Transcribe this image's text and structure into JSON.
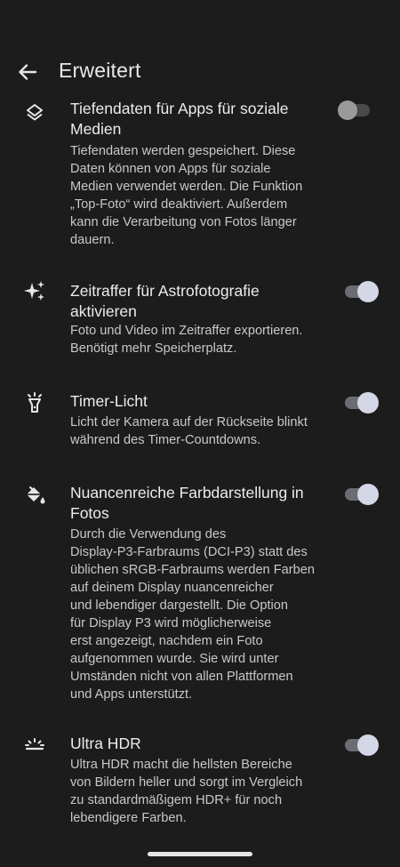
{
  "header": {
    "back_icon": "arrow-back-icon",
    "title": "Erweitert"
  },
  "settings": [
    {
      "icon": "layers-icon",
      "title": "Tiefendaten für Apps für soziale Medien",
      "title_lines": [
        "Tiefendaten für Apps für soziale",
        "Medien"
      ],
      "description_lines": [
        "Tiefendaten werden gespeichert. Diese",
        "Daten können von Apps für soziale",
        "Medien verwendet werden. Die Funktion",
        "„Top-Foto“ wird deaktiviert. Außerdem",
        "kann die Verarbeitung von Fotos länger",
        "dauern."
      ],
      "enabled": false
    },
    {
      "icon": "sparkle-icon",
      "title": "Zeitraffer für Astrofotografie aktivieren",
      "title_lines": [
        "Zeitraffer für Astrofotografie",
        "aktivieren"
      ],
      "description_lines": [
        "Foto und Video im Zeitraffer exportieren.",
        "Benötigt mehr Speicherplatz."
      ],
      "enabled": true
    },
    {
      "icon": "flashlight-icon",
      "title": "Timer-Licht",
      "title_lines": [
        "Timer-Licht"
      ],
      "description_lines": [
        "Licht der Kamera auf der Rückseite blinkt",
        "während des Timer-Countdowns."
      ],
      "enabled": true
    },
    {
      "icon": "paint-bucket-icon",
      "title": "Nuancenreiche Farbdarstellung in Fotos",
      "title_lines": [
        "Nuancenreiche Farbdarstellung in",
        "Fotos"
      ],
      "description_lines": [
        "Durch die Verwendung des",
        "Display-P3-Farbraums (DCI-P3) statt des",
        "üblichen sRGB-Farbraums werden Farben",
        "auf deinem Display nuancenreicher",
        "und lebendiger dargestellt. Die Option",
        "für Display P3 wird möglicherweise",
        "erst angezeigt, nachdem ein Foto",
        "aufgenommen wurde. Sie wird unter",
        "Umständen nicht von allen Plattformen",
        "und Apps unterstützt."
      ],
      "enabled": true
    },
    {
      "icon": "hdr-sunrise-icon",
      "title": "Ultra HDR",
      "title_lines": [
        "Ultra HDR"
      ],
      "description_lines": [
        "Ultra HDR macht die hellsten Bereiche",
        "von Bildern heller und sorgt im Vergleich",
        "zu standardmäßigem HDR+ für noch",
        "lebendigere Farben."
      ],
      "enabled": true
    }
  ],
  "colors": {
    "background": "#1c1c1c",
    "toggle_thumb_on": "#d4d8e6",
    "toggle_track_on": "#6b6d74",
    "text_primary": "#ececec",
    "text_secondary": "#c8c8c8"
  }
}
